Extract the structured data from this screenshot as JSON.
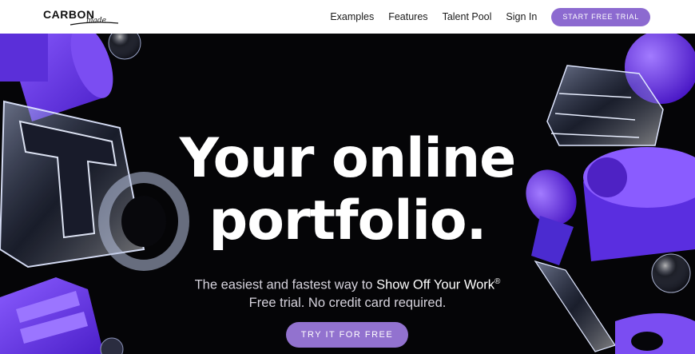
{
  "brand": {
    "name": "CARBON",
    "sub": "made"
  },
  "nav": {
    "items": [
      "Examples",
      "Features",
      "Talent Pool",
      "Sign In"
    ],
    "cta": "START FREE TRIAL"
  },
  "hero": {
    "title_line1": "Your online",
    "title_line2": "portfolio.",
    "subtitle_lead": "The easiest and fastest way to ",
    "subtitle_highlight": "Show Off Your Work",
    "subtitle_mark": "®",
    "subtitle_line2": "Free trial. No credit card required.",
    "cta": "TRY IT FOR FREE"
  },
  "colors": {
    "accent": "#8c6ad0",
    "hero_bg": "#050507",
    "purple": "#6b3ff0"
  }
}
